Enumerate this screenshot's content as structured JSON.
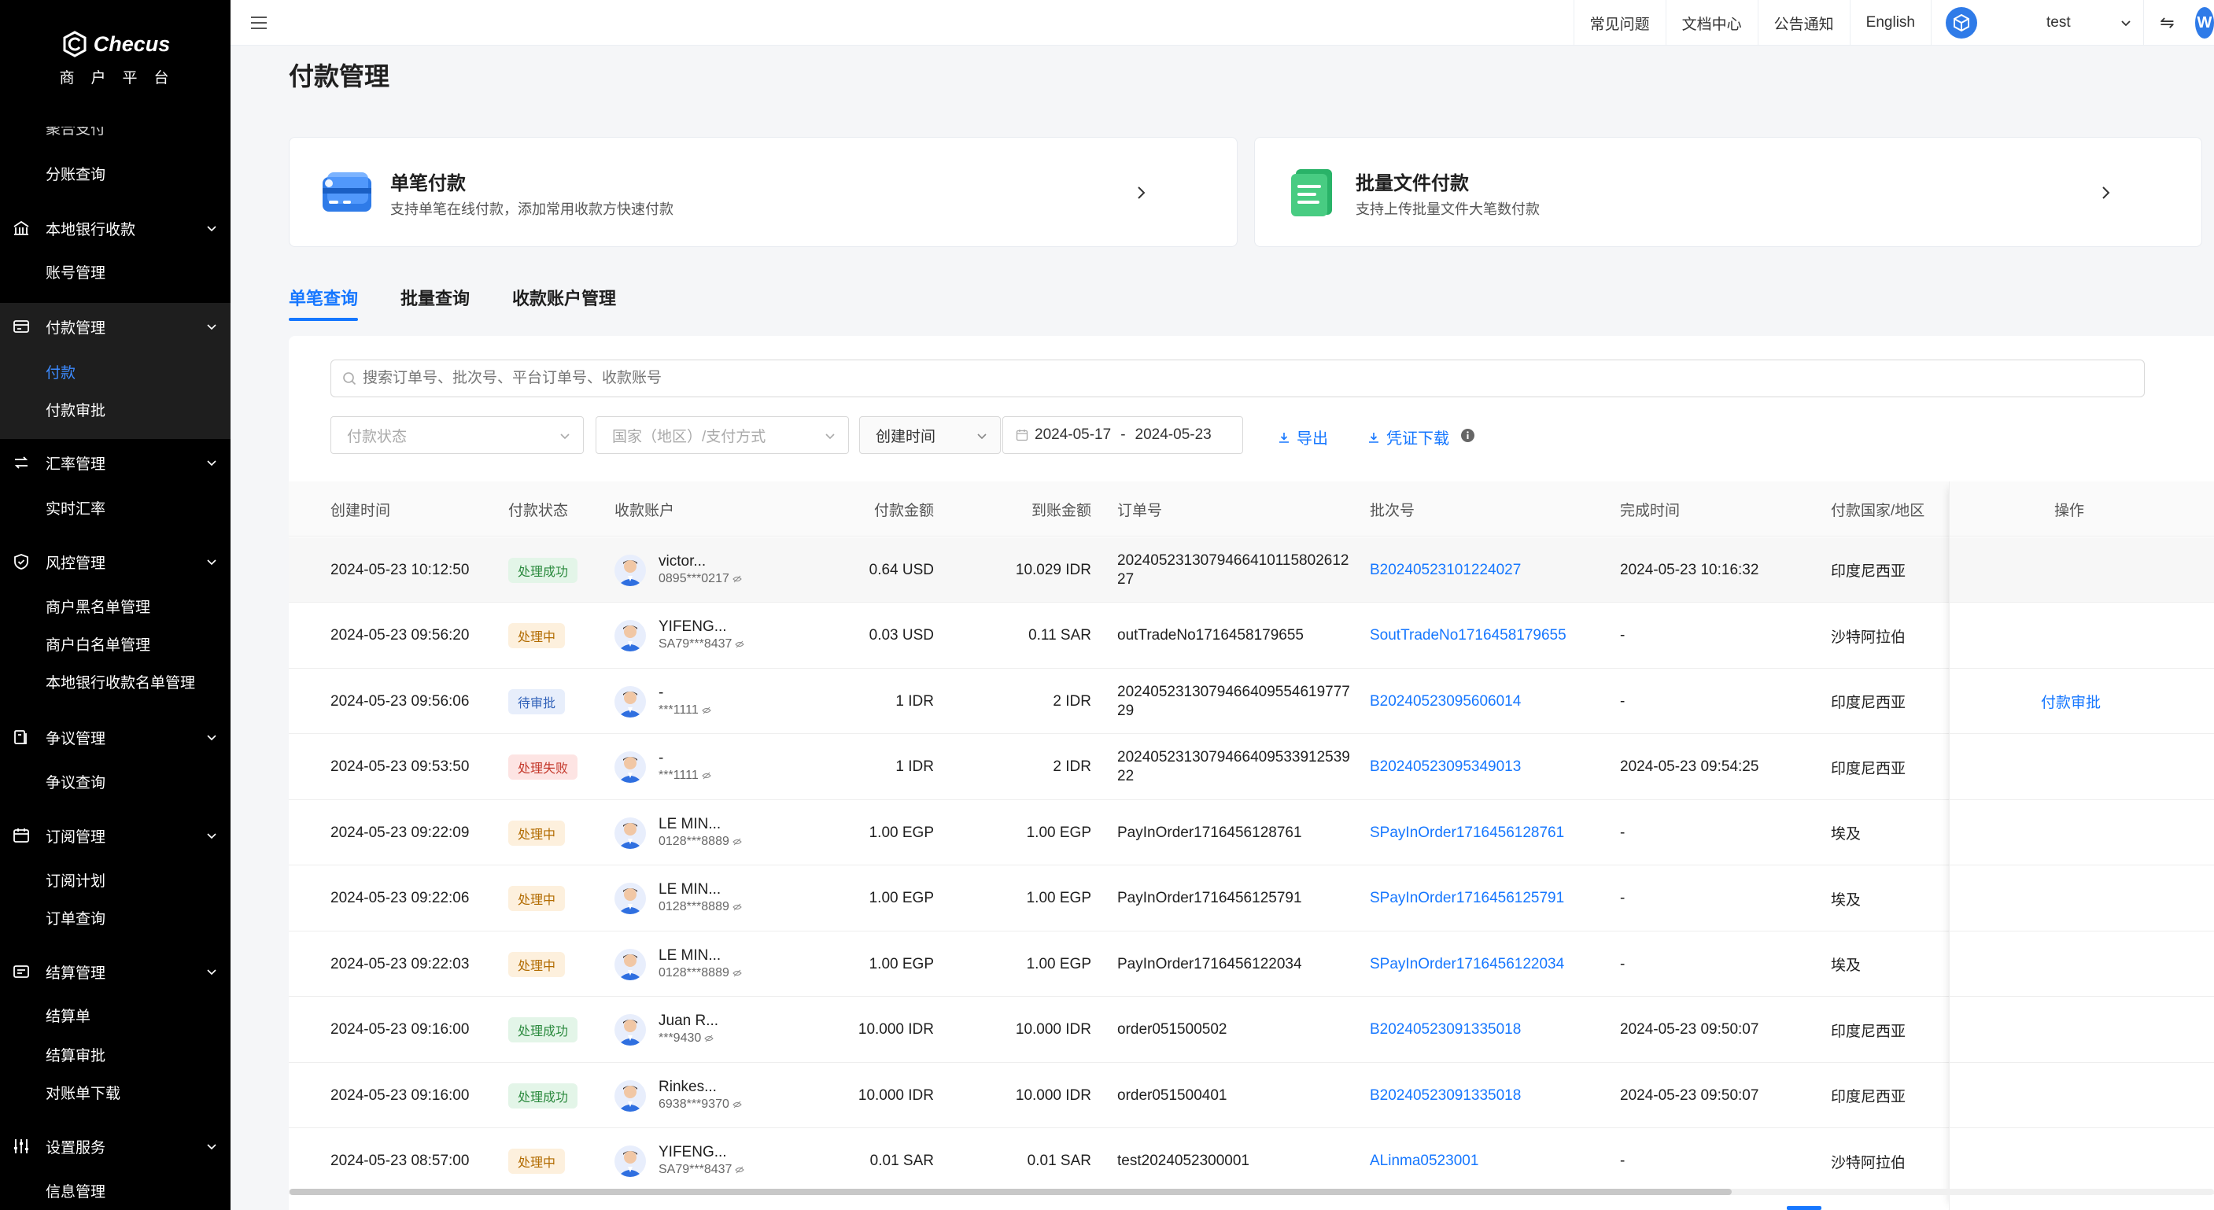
{
  "brand": {
    "name": "Checus",
    "subtitle": "商户平台"
  },
  "sidebar": {
    "clipped_item": "聚合支付",
    "items": [
      {
        "type": "sub",
        "label": "分账查询"
      },
      {
        "type": "group",
        "label": "本地银行收款",
        "icon": "bank-icon"
      },
      {
        "type": "sub",
        "label": "账号管理"
      },
      {
        "type": "group",
        "label": "付款管理",
        "icon": "payment-icon"
      },
      {
        "type": "sub",
        "label": "付款",
        "active": true
      },
      {
        "type": "sub",
        "label": "付款审批"
      },
      {
        "type": "group",
        "label": "汇率管理",
        "icon": "exchange-icon"
      },
      {
        "type": "sub",
        "label": "实时汇率"
      },
      {
        "type": "group",
        "label": "风控管理",
        "icon": "shield-icon"
      },
      {
        "type": "sub",
        "label": "商户黑名单管理"
      },
      {
        "type": "sub",
        "label": "商户白名单管理"
      },
      {
        "type": "sub",
        "label": "本地银行收款名单管理"
      },
      {
        "type": "group",
        "label": "争议管理",
        "icon": "dispute-icon"
      },
      {
        "type": "sub",
        "label": "争议查询"
      },
      {
        "type": "group",
        "label": "订阅管理",
        "icon": "calendar-icon"
      },
      {
        "type": "sub",
        "label": "订阅计划"
      },
      {
        "type": "sub",
        "label": "订单查询"
      },
      {
        "type": "group",
        "label": "结算管理",
        "icon": "settlement-icon"
      },
      {
        "type": "sub",
        "label": "结算单"
      },
      {
        "type": "sub",
        "label": "结算审批"
      },
      {
        "type": "sub",
        "label": "对账单下载"
      },
      {
        "type": "group",
        "label": "设置服务",
        "icon": "settings-sliders-icon"
      },
      {
        "type": "sub",
        "label": "信息管理"
      }
    ]
  },
  "topbar": {
    "links": [
      "常见问题",
      "文档中心",
      "公告通知",
      "English"
    ],
    "username": "test",
    "edge_avatar": "W"
  },
  "page": {
    "title": "付款管理",
    "cards": [
      {
        "title": "单笔付款",
        "desc": "支持单笔在线付款，添加常用收款方快速付款"
      },
      {
        "title": "批量文件付款",
        "desc": "支持上传批量文件大笔数付款"
      }
    ],
    "tabs": [
      {
        "label": "单笔查询",
        "active": true
      },
      {
        "label": "批量查询"
      },
      {
        "label": "收款账户管理"
      }
    ]
  },
  "filters": {
    "search_placeholder": "搜索订单号、批次号、平台订单号、收款账号",
    "status_placeholder": "付款状态",
    "country_placeholder": "国家（地区）/支付方式",
    "time_type": "创建时间",
    "date_start": "2024-05-17",
    "date_sep": "-",
    "date_end": "2024-05-23",
    "export_label": "导出",
    "voucher_label": "凭证下载"
  },
  "table": {
    "columns": [
      "创建时间",
      "付款状态",
      "收款账户",
      "付款金额",
      "到账金额",
      "订单号",
      "批次号",
      "完成时间",
      "付款国家/地区",
      "操作"
    ],
    "rows": [
      {
        "created": "2024-05-23 10:12:50",
        "status": "处理成功",
        "status_type": "success",
        "payee_name": "victor...",
        "payee_acct": "0895***0217",
        "pay_amount": "0.64 USD",
        "recv_amount": "10.029 IDR",
        "order_l1": "2024052313079466410115802612",
        "order_l2": "27",
        "batch": "B20240523101224027",
        "finished": "2024-05-23 10:16:32",
        "country": "印度尼西亚",
        "action": ""
      },
      {
        "created": "2024-05-23 09:56:20",
        "status": "处理中",
        "status_type": "processing",
        "payee_name": "YIFENG...",
        "payee_acct": "SA79***8437",
        "pay_amount": "0.03 USD",
        "recv_amount": "0.11 SAR",
        "order_l1": "outTradeNo1716458179655",
        "order_l2": "",
        "batch": "SoutTradeNo1716458179655",
        "finished": "-",
        "country": "沙特阿拉伯",
        "action": ""
      },
      {
        "created": "2024-05-23 09:56:06",
        "status": "待审批",
        "status_type": "pending",
        "payee_name": "-",
        "payee_acct": "***1111",
        "pay_amount": "1 IDR",
        "recv_amount": "2 IDR",
        "order_l1": "2024052313079466409554619777",
        "order_l2": "29",
        "batch": "B20240523095606014",
        "finished": "-",
        "country": "印度尼西亚",
        "action": "付款审批"
      },
      {
        "created": "2024-05-23 09:53:50",
        "status": "处理失败",
        "status_type": "failed",
        "payee_name": "-",
        "payee_acct": "***1111",
        "pay_amount": "1 IDR",
        "recv_amount": "2 IDR",
        "order_l1": "2024052313079466409533912539",
        "order_l2": "22",
        "batch": "B20240523095349013",
        "finished": "2024-05-23 09:54:25",
        "country": "印度尼西亚",
        "action": ""
      },
      {
        "created": "2024-05-23 09:22:09",
        "status": "处理中",
        "status_type": "processing",
        "payee_name": "LE MIN...",
        "payee_acct": "0128***8889",
        "pay_amount": "1.00 EGP",
        "recv_amount": "1.00 EGP",
        "order_l1": "PayInOrder1716456128761",
        "order_l2": "",
        "batch": "SPayInOrder1716456128761",
        "finished": "-",
        "country": "埃及",
        "action": ""
      },
      {
        "created": "2024-05-23 09:22:06",
        "status": "处理中",
        "status_type": "processing",
        "payee_name": "LE MIN...",
        "payee_acct": "0128***8889",
        "pay_amount": "1.00 EGP",
        "recv_amount": "1.00 EGP",
        "order_l1": "PayInOrder1716456125791",
        "order_l2": "",
        "batch": "SPayInOrder1716456125791",
        "finished": "-",
        "country": "埃及",
        "action": ""
      },
      {
        "created": "2024-05-23 09:22:03",
        "status": "处理中",
        "status_type": "processing",
        "payee_name": "LE MIN...",
        "payee_acct": "0128***8889",
        "pay_amount": "1.00 EGP",
        "recv_amount": "1.00 EGP",
        "order_l1": "PayInOrder1716456122034",
        "order_l2": "",
        "batch": "SPayInOrder1716456122034",
        "finished": "-",
        "country": "埃及",
        "action": ""
      },
      {
        "created": "2024-05-23 09:16:00",
        "status": "处理成功",
        "status_type": "success",
        "payee_name": "Juan R...",
        "payee_acct": "***9430",
        "pay_amount": "10.000 IDR",
        "recv_amount": "10.000 IDR",
        "order_l1": "order051500502",
        "order_l2": "",
        "batch": "B20240523091335018",
        "finished": "2024-05-23 09:50:07",
        "country": "印度尼西亚",
        "action": ""
      },
      {
        "created": "2024-05-23 09:16:00",
        "status": "处理成功",
        "status_type": "success",
        "payee_name": "Rinkes...",
        "payee_acct": "6938***9370",
        "pay_amount": "10.000 IDR",
        "recv_amount": "10.000 IDR",
        "order_l1": "order051500401",
        "order_l2": "",
        "batch": "B20240523091335018",
        "finished": "2024-05-23 09:50:07",
        "country": "印度尼西亚",
        "action": ""
      },
      {
        "created": "2024-05-23 08:57:00",
        "status": "处理中",
        "status_type": "processing",
        "payee_name": "YIFENG...",
        "payee_acct": "SA79***8437",
        "pay_amount": "0.01 SAR",
        "recv_amount": "0.01 SAR",
        "order_l1": "test2024052300001",
        "order_l2": "",
        "batch": "ALinma0523001",
        "finished": "-",
        "country": "沙特阿拉伯",
        "action": ""
      }
    ]
  },
  "colors": {
    "primary": "#1677ff",
    "sidebar_bg": "#000000",
    "active_nav": "#3d8bff"
  }
}
